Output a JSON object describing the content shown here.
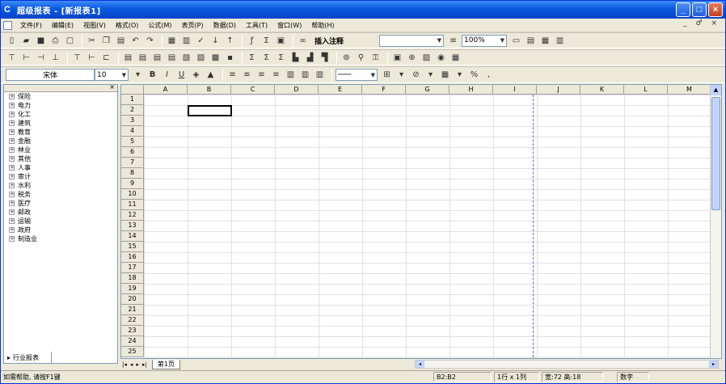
{
  "window": {
    "title": "超级报表 - [新报表1]",
    "app_icon": "C"
  },
  "menu": {
    "items": [
      "文件(F)",
      "编辑(E)",
      "视图(V)",
      "格式(O)",
      "公式(M)",
      "表页(P)",
      "数据(D)",
      "工具(T)",
      "窗口(W)",
      "帮助(H)"
    ],
    "mdi_controls": "_ ♂ ×"
  },
  "toolbar1": {
    "insert_comment_label": "插入注释",
    "zoom_value": "100%"
  },
  "toolbar3": {
    "font_name": "宋体",
    "font_size": "10"
  },
  "left_pane": {
    "industries": [
      "保险",
      "电力",
      "化工",
      "建筑",
      "教育",
      "金融",
      "林业",
      "其他",
      "人事",
      "审计",
      "水利",
      "税务",
      "医疗",
      "邮政",
      "运输",
      "政府",
      "制造业"
    ],
    "tab_label": "行业报表"
  },
  "sheet": {
    "columns": [
      "A",
      "B",
      "C",
      "D",
      "E",
      "F",
      "G",
      "H",
      "I",
      "J",
      "K",
      "L",
      "M"
    ],
    "rows": [
      "1",
      "2",
      "3",
      "4",
      "5",
      "6",
      "7",
      "8",
      "9",
      "10",
      "11",
      "12",
      "13",
      "14",
      "15",
      "16",
      "17",
      "18",
      "19",
      "20",
      "21",
      "22",
      "23",
      "24",
      "25"
    ],
    "tab_label": "第1页"
  },
  "statusbar": {
    "help_text": "如需帮助, 请按F1键",
    "cell_ref": "B2:B2",
    "selection_size": "1行 x 1列",
    "dimensions": "宽:72 高:18",
    "num_mode": "数字"
  }
}
